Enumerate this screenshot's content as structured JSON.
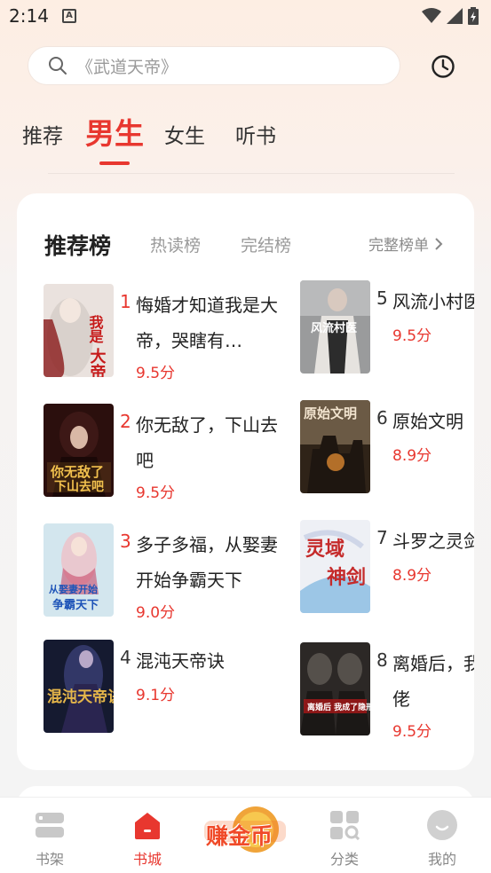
{
  "status_bar": {
    "time": "2:14",
    "notification_icon": "A"
  },
  "search": {
    "placeholder": "《武道天帝》"
  },
  "gender_tabs": [
    {
      "label": "推荐",
      "active": false
    },
    {
      "label": "男生",
      "active": true
    },
    {
      "label": "女生",
      "active": false
    },
    {
      "label": "听书",
      "active": false
    }
  ],
  "ranking": {
    "title": "推荐榜",
    "tabs": [
      "热读榜",
      "完结榜"
    ],
    "full_list_label": "完整榜单",
    "books": [
      {
        "rank": "1",
        "title": "悔婚才知道我是大帝，哭瞎有…",
        "score": "9.5分",
        "cover_text": "我是大帝",
        "cover_bg": "#e9e2df"
      },
      {
        "rank": "2",
        "title": "你无敌了，下山去吧",
        "score": "9.5分",
        "cover_text": "你无敌了下山去吧",
        "cover_bg": "#3a1612"
      },
      {
        "rank": "3",
        "title": "多子多福，从娶妻开始争霸天下",
        "score": "9.0分",
        "cover_text": "从娶妻开始争霸天下",
        "cover_bg": "#cfe3ec"
      },
      {
        "rank": "4",
        "title": "混沌天帝诀",
        "score": "9.1分",
        "cover_text": "混沌天帝诀",
        "cover_bg": "#1a2038"
      },
      {
        "rank": "5",
        "title": "风流小村医",
        "score": "9.5分",
        "cover_text": "风流村医",
        "cover_bg": "#8a8c8e"
      },
      {
        "rank": "6",
        "title": "原始文明",
        "score": "8.9分",
        "cover_text": "原始文明",
        "cover_bg": "#3a2a1e"
      },
      {
        "rank": "7",
        "title": "斗罗之灵剑",
        "score": "8.9分",
        "cover_text": "灵域神剑",
        "cover_bg": "#eef0f5"
      },
      {
        "rank": "8",
        "title": "离婚后，我隐形大佬",
        "score": "9.5分",
        "cover_text": "离婚后 我成了隐形大佬",
        "cover_bg": "#2e2a28"
      }
    ]
  },
  "bottom_nav": [
    {
      "label": "书架",
      "icon": "bookshelf-icon",
      "active": false
    },
    {
      "label": "书城",
      "icon": "bookstore-icon",
      "active": true
    },
    {
      "label": "赚金币",
      "icon": "earn-coins-icon",
      "active": false
    },
    {
      "label": "分类",
      "icon": "category-icon",
      "active": false
    },
    {
      "label": "我的",
      "icon": "profile-icon",
      "active": false
    }
  ],
  "colors": {
    "accent": "#e8372f",
    "rank_red": "#e8372f",
    "rank_gray": "#333333"
  }
}
